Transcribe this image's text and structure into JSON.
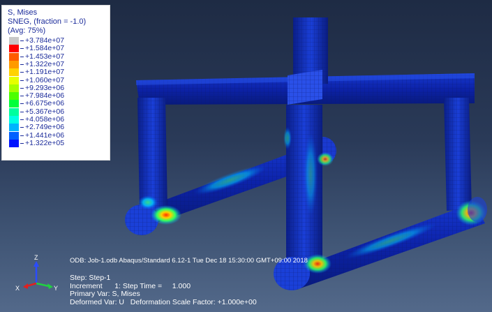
{
  "legend": {
    "title_lines": [
      "S, Mises",
      "SNEG, (fraction = -1.0)",
      "(Avg: 75%)"
    ],
    "levels": [
      {
        "label": "+3.784e+07",
        "color": "#c8c8c8"
      },
      {
        "label": "+1.584e+07",
        "color": "#ff0000"
      },
      {
        "label": "+1.453e+07",
        "color": "#ff5a00"
      },
      {
        "label": "+1.322e+07",
        "color": "#ff9a00"
      },
      {
        "label": "+1.191e+07",
        "color": "#ffd200"
      },
      {
        "label": "+1.060e+07",
        "color": "#e6ff00"
      },
      {
        "label": "+9.293e+06",
        "color": "#a6ff00"
      },
      {
        "label": "+7.984e+06",
        "color": "#4cff00"
      },
      {
        "label": "+6.675e+06",
        "color": "#00ff3a"
      },
      {
        "label": "+5.367e+06",
        "color": "#00ff9e"
      },
      {
        "label": "+4.058e+06",
        "color": "#00ffe4"
      },
      {
        "label": "+2.749e+06",
        "color": "#00b4ff"
      },
      {
        "label": "+1.441e+06",
        "color": "#0060ff"
      },
      {
        "label": "+1.322e+05",
        "color": "#0014ff"
      }
    ]
  },
  "info_line": "ODB: Job-1.odb    Abaqus/Standard 6.12-1    Tue Dec 18 15:30:00 GMT+09:00 2018",
  "step_lines": [
    "Step: Step-1",
    "Increment      1: Step Time =     1.000",
    "Primary Var: S, Mises",
    "Deformed Var: U   Deformation Scale Factor: +1.000e+00"
  ],
  "triad": {
    "x": "X",
    "y": "Y",
    "z": "Z"
  }
}
